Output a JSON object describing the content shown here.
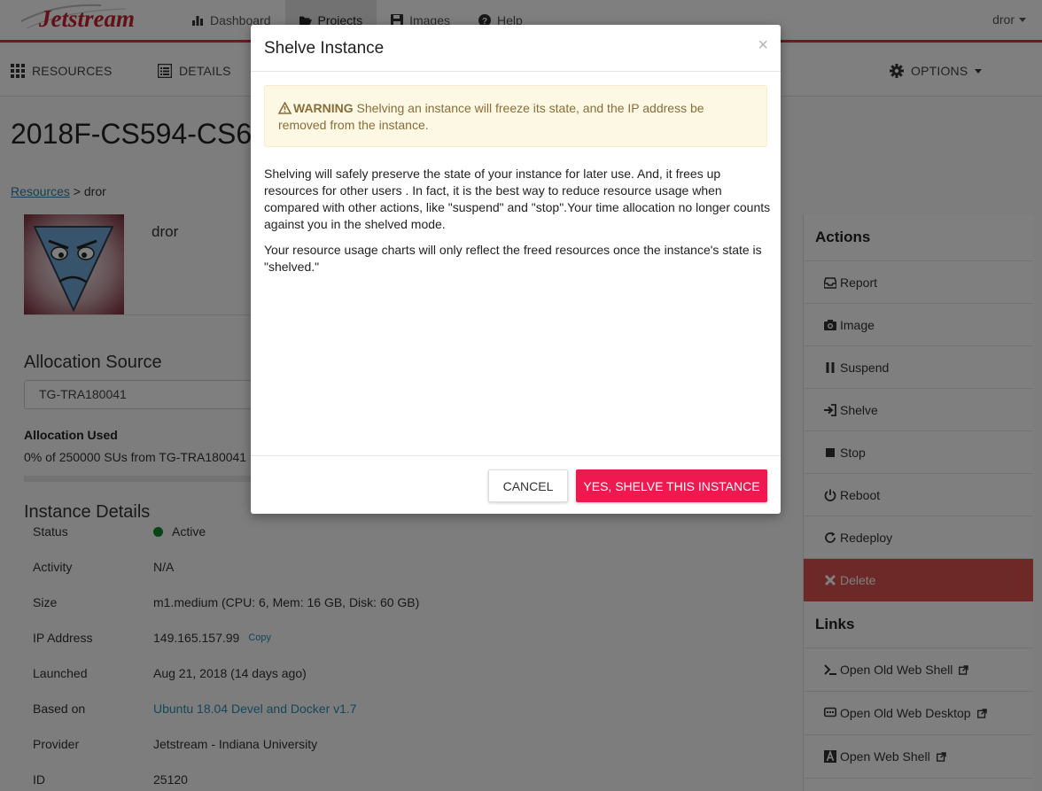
{
  "header": {
    "logo_text": "Jetstream",
    "nav": [
      {
        "label": "Dashboard",
        "icon": "bar-chart-icon"
      },
      {
        "label": "Projects",
        "icon": "folder-open-icon",
        "active": true
      },
      {
        "label": "Images",
        "icon": "floppy-disk-icon"
      },
      {
        "label": "Help",
        "icon": "question-circle-icon"
      }
    ],
    "user": "dror",
    "accent_color": "#d93240"
  },
  "subnav": {
    "resources": "RESOURCES",
    "details": "DETAILS",
    "options": "OPTIONS"
  },
  "page": {
    "title": "2018F-CS594-CS6",
    "breadcrumb_link": "Resources",
    "breadcrumb_rest": " > dror",
    "owner_name": "dror"
  },
  "allocation": {
    "heading": "Allocation Source",
    "selected": "TG-TRA180041",
    "used_label": "Allocation Used",
    "used_text": "0% of 250000 SUs from TG-TRA180041",
    "used_percent": 0
  },
  "instance_details": {
    "heading": "Instance Details",
    "rows": [
      {
        "key": "Status",
        "value": "Active"
      },
      {
        "key": "Activity",
        "value": "N/A"
      },
      {
        "key": "Size",
        "value": "m1.medium (CPU: 6, Mem: 16 GB, Disk: 60 GB)"
      },
      {
        "key": "IP Address",
        "value": "149.165.157.99",
        "extra": "Copy"
      },
      {
        "key": "Launched",
        "value": "Aug 21, 2018 (14 days ago)"
      },
      {
        "key": "Based on",
        "value": "Ubuntu 18.04 Devel and Docker v1.7"
      },
      {
        "key": "Provider",
        "value": "Jetstream - Indiana University"
      },
      {
        "key": "ID",
        "value": "25120"
      }
    ],
    "status_color": "#0f8a2c"
  },
  "actions": {
    "heading": "Actions",
    "items": [
      {
        "label": "Report",
        "icon": "inbox-icon"
      },
      {
        "label": "Image",
        "icon": "camera-icon"
      },
      {
        "label": "Suspend",
        "icon": "pause-icon"
      },
      {
        "label": "Shelve",
        "icon": "sign-in-icon"
      },
      {
        "label": "Stop",
        "icon": "stop-icon"
      },
      {
        "label": "Reboot",
        "icon": "power-icon"
      },
      {
        "label": "Redeploy",
        "icon": "refresh-icon"
      },
      {
        "label": "Delete",
        "icon": "x-icon",
        "danger": true
      }
    ],
    "links_heading": "Links",
    "links": [
      {
        "label": "Open Old Web Shell",
        "icon": "terminal-icon"
      },
      {
        "label": "Open Old Web Desktop",
        "icon": "desktop-icon"
      },
      {
        "label": "Open Web Shell",
        "icon": "shell-icon"
      }
    ],
    "danger_color": "#d9534f"
  },
  "modal": {
    "title": "Shelve Instance",
    "close": "×",
    "warning_label": "WARNING",
    "warning_text": " Shelving an instance will freeze its state, and the IP address be removed from the instance.",
    "paragraph1": "Shelving will safely preserve the state of your instance for later use. And, it frees up resources for other users . In fact, it is the best way to reduce resource usage when compared with other actions, like \"suspend\" and \"stop\".Your time allocation no longer counts against you in the shelved mode.",
    "paragraph2": "Your resource usage charts will only reflect the freed resources once the instance's state is \"shelved.\"",
    "cancel_label": "CANCEL",
    "confirm_label": "YES, SHELVE THIS INSTANCE",
    "confirm_color": "#f0194f"
  }
}
